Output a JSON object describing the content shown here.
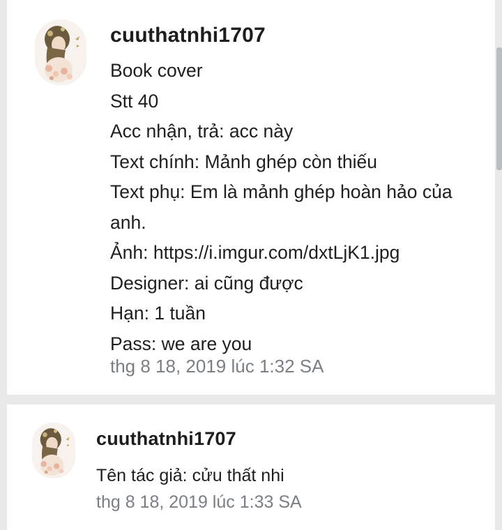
{
  "comments": [
    {
      "username": "cuuthatnhi1707",
      "avatar_icon": "avatar-girl-floral-icon",
      "lines": [
        "Book cover",
        "Stt 40",
        "Acc nhận, trả: acc này",
        "Text chính: Mảnh ghép còn thiếu",
        "Text phụ: Em là mảnh ghép hoàn hảo của anh.",
        "Ảnh: https://i.imgur.com/dxtLjK1.jpg",
        "Designer: ai cũng được",
        "Hạn: 1 tuần",
        "Pass: we are you"
      ],
      "timestamp": "thg 8 18, 2019 lúc 1:32 SA"
    },
    {
      "username": "cuuthatnhi1707",
      "avatar_icon": "avatar-girl-floral-icon",
      "lines": [
        "Tên tác giả: cửu thất nhi"
      ],
      "timestamp": "thg 8 18, 2019 lúc 1:33 SA"
    }
  ],
  "colors": {
    "page_background": "#e9e9ea",
    "card_background": "#ffffff",
    "text": "#1f1f1f",
    "timestamp": "#7a7f86"
  }
}
